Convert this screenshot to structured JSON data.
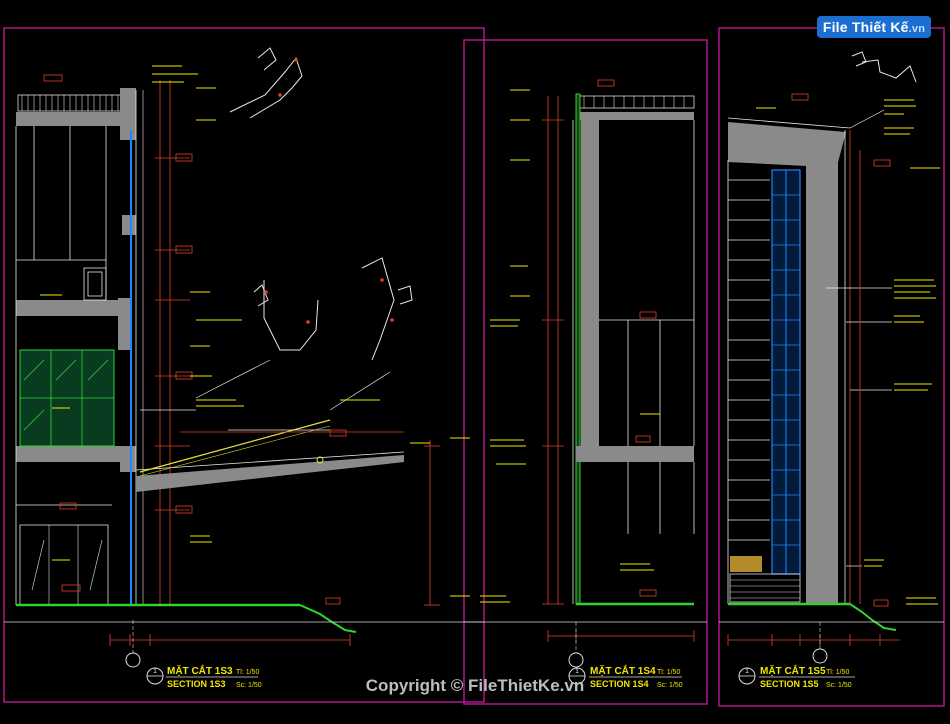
{
  "logo": {
    "text": "File Thiết Kế",
    "suffix": ".vn"
  },
  "copyright": "Copyright © FileThietKe.vn",
  "sections": [
    {
      "vn": "MẶT CẮT 1S3",
      "en": "SECTION 1S3",
      "scale_vn": "Tl: 1/50",
      "scale_en": "Sc: 1/50",
      "tag": "1"
    },
    {
      "vn": "MẶT CẮT 1S4",
      "en": "SECTION 1S4",
      "scale_vn": "Tl: 1/50",
      "scale_en": "Sc: 1/50",
      "tag": "1"
    },
    {
      "vn": "MẶT CẮT 1S5",
      "en": "SECTION 1S5",
      "scale_vn": "Tl: 1/50",
      "scale_en": "Sc: 1/50",
      "tag": "1"
    }
  ],
  "colors": {
    "background": "#000000",
    "frame": "#b0178a",
    "wall_fill": "#8a8a8a",
    "glazing": "#1e86ff",
    "ground": "#2fd42f",
    "dimension": "#e0402a",
    "annotation": "#f2e600",
    "slab_edge": "#e8e8e8"
  }
}
